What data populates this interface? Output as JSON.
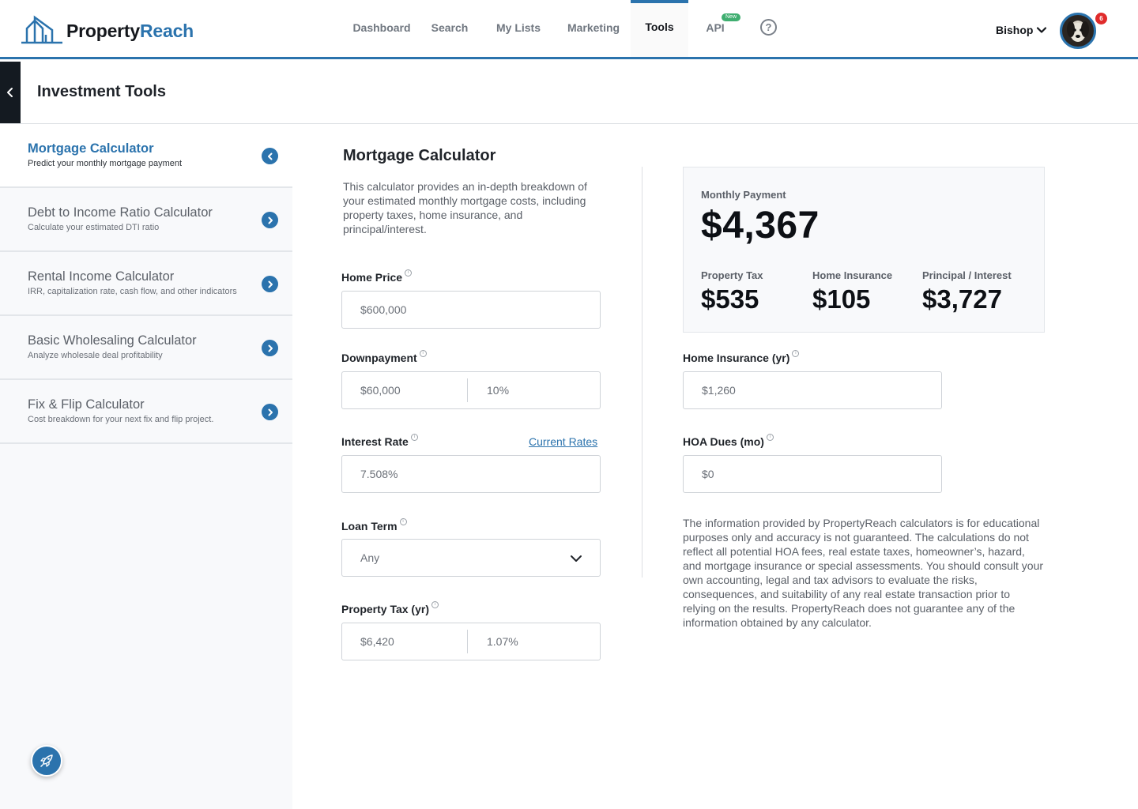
{
  "brand": {
    "name_part1": "Property",
    "name_part2": "Reach"
  },
  "nav": {
    "dashboard": "Dashboard",
    "search": "Search",
    "my_lists": "My Lists",
    "marketing": "Marketing",
    "tools": "Tools",
    "api": "API",
    "api_badge": "New",
    "help": "?"
  },
  "user": {
    "name": "Bishop",
    "notifications": "6"
  },
  "page_title": "Investment Tools",
  "sidebar": {
    "items": [
      {
        "title": "Mortgage Calculator",
        "subtitle": "Predict your monthly mortgage payment",
        "active": true
      },
      {
        "title": "Debt to Income Ratio Calculator",
        "subtitle": "Calculate your estimated DTI ratio"
      },
      {
        "title": "Rental Income Calculator",
        "subtitle": "IRR, capitalization rate, cash flow, and other indicators"
      },
      {
        "title": "Basic Wholesaling Calculator",
        "subtitle": "Analyze wholesale deal profitability"
      },
      {
        "title": "Fix & Flip Calculator",
        "subtitle": "Cost breakdown for your next fix and flip project."
      }
    ]
  },
  "calculator": {
    "title": "Mortgage Calculator",
    "description": "This calculator provides an in-depth breakdown of your estimated monthly mortgage costs, including property taxes, home insurance, and principal/interest.",
    "home_price": {
      "label": "Home Price",
      "value": "$600,000"
    },
    "downpayment": {
      "label": "Downpayment",
      "amount": "$60,000",
      "percent": "10%"
    },
    "interest_rate": {
      "label": "Interest Rate",
      "value": "7.508%",
      "link": "Current Rates"
    },
    "loan_term": {
      "label": "Loan Term",
      "value": "Any"
    },
    "property_tax": {
      "label": "Property Tax (yr)",
      "amount": "$6,420",
      "percent": "1.07%"
    },
    "home_insurance": {
      "label": "Home Insurance (yr)",
      "value": "$1,260"
    },
    "hoa_dues": {
      "label": "HOA Dues (mo)",
      "value": "$0"
    }
  },
  "summary": {
    "monthly_label": "Monthly Payment",
    "monthly_value": "$4,367",
    "property_tax_label": "Property Tax",
    "property_tax_value": "$535",
    "home_insurance_label": "Home Insurance",
    "home_insurance_value": "$105",
    "principal_label": "Principal / Interest",
    "principal_value": "$3,727"
  },
  "disclaimer": "The information provided by PropertyReach calculators is for educational purposes only and accuracy is not guaranteed. The calculations do not reflect all potential HOA fees, real estate taxes, homeowner’s, hazard, and mortgage insurance or special assessments. You should consult your own accounting, legal and tax advisors to evaluate the risks, consequences, and suitability of any real estate transaction prior to relying on the results. PropertyReach does not guarantee any of the information obtained by any calculator.",
  "icons": {
    "logo": "house-outline-icon",
    "help": "question-circle-icon",
    "user_menu": "chevron-down-icon",
    "collapse": "chevron-left-icon",
    "sidebar_active": "chevron-left-circle-icon",
    "sidebar_inactive": "chevron-right-circle-icon",
    "info": "info-circle-icon",
    "select": "chevron-down-icon",
    "rocket": "rocket-icon"
  },
  "colors": {
    "accent": "#2b73ad",
    "dark": "#141a21",
    "badge_new": "#3fae70",
    "notification": "#e02b2b"
  }
}
